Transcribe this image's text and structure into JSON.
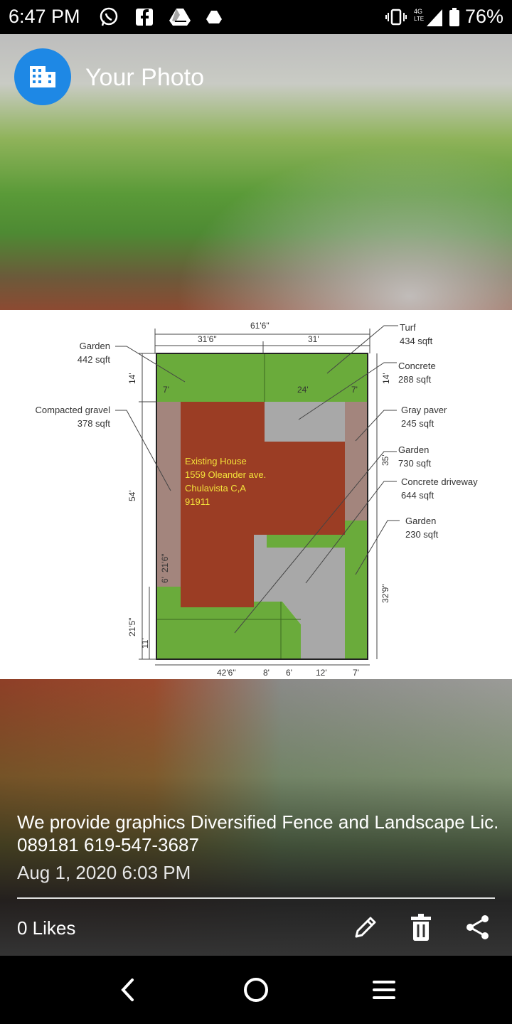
{
  "status_bar": {
    "time": "6:47 PM",
    "left_icons": [
      "whatsapp-icon",
      "facebook-icon",
      "drive-icon",
      "triangle-icon"
    ],
    "network": "4G LTE",
    "battery": "76%"
  },
  "header": {
    "title": "Your Photo",
    "avatar_icon": "building-icon",
    "accent": "#1e88e5"
  },
  "plan": {
    "dims": {
      "total_width": "61'6\"",
      "left_width": "31'6\"",
      "right_width": "31'",
      "top_depth": "14'",
      "top_depth_right": "14'",
      "side_width": "7'",
      "mid_width": "24'",
      "mid_width_right": "7'",
      "house_depth": "54'",
      "right_depth": "35'",
      "gravel_depth": "21'6\"",
      "gravel_small": "6'",
      "bottom_left_depth": "21'5\"",
      "bottom_small": "11'",
      "right_lower_depth": "32'9\"",
      "bottom_1": "42'6\"",
      "bottom_2": "8'",
      "bottom_3": "6'",
      "bottom_4": "12'",
      "bottom_5": "7'"
    },
    "house_lines": [
      "Existing House",
      "1559 Oleander ave.",
      "Chulavista C,A",
      "91911"
    ],
    "labels": {
      "garden_left_name": "Garden",
      "garden_left_area": "442 sqft",
      "gravel_name": "Compacted gravel",
      "gravel_area": "378 sqft",
      "turf_name": "Turf",
      "turf_area": "434 sqft",
      "concrete_name": "Concrete",
      "concrete_area": "288 sqft",
      "paver_name": "Gray paver",
      "paver_area": "245 sqft",
      "garden_mid_name": "Garden",
      "garden_mid_area": "730 sqft",
      "driveway_name": "Concrete driveway",
      "driveway_area": "644 sqft",
      "garden_right_name": "Garden",
      "garden_right_area": "230 sqft"
    },
    "colors": {
      "garden": "#6aab3b",
      "house": "#9b3d24",
      "concrete": "#a8a8a8",
      "gravel": "#a3857d",
      "house_text": "#f4e23a"
    }
  },
  "caption": "We provide graphics Diversified Fence and Landscape Lic. 089181 619-547-3687",
  "date": "Aug 1, 2020 6:03 PM",
  "likes": "0 Likes",
  "actions": [
    "edit-icon",
    "trash-icon",
    "share-icon"
  ]
}
